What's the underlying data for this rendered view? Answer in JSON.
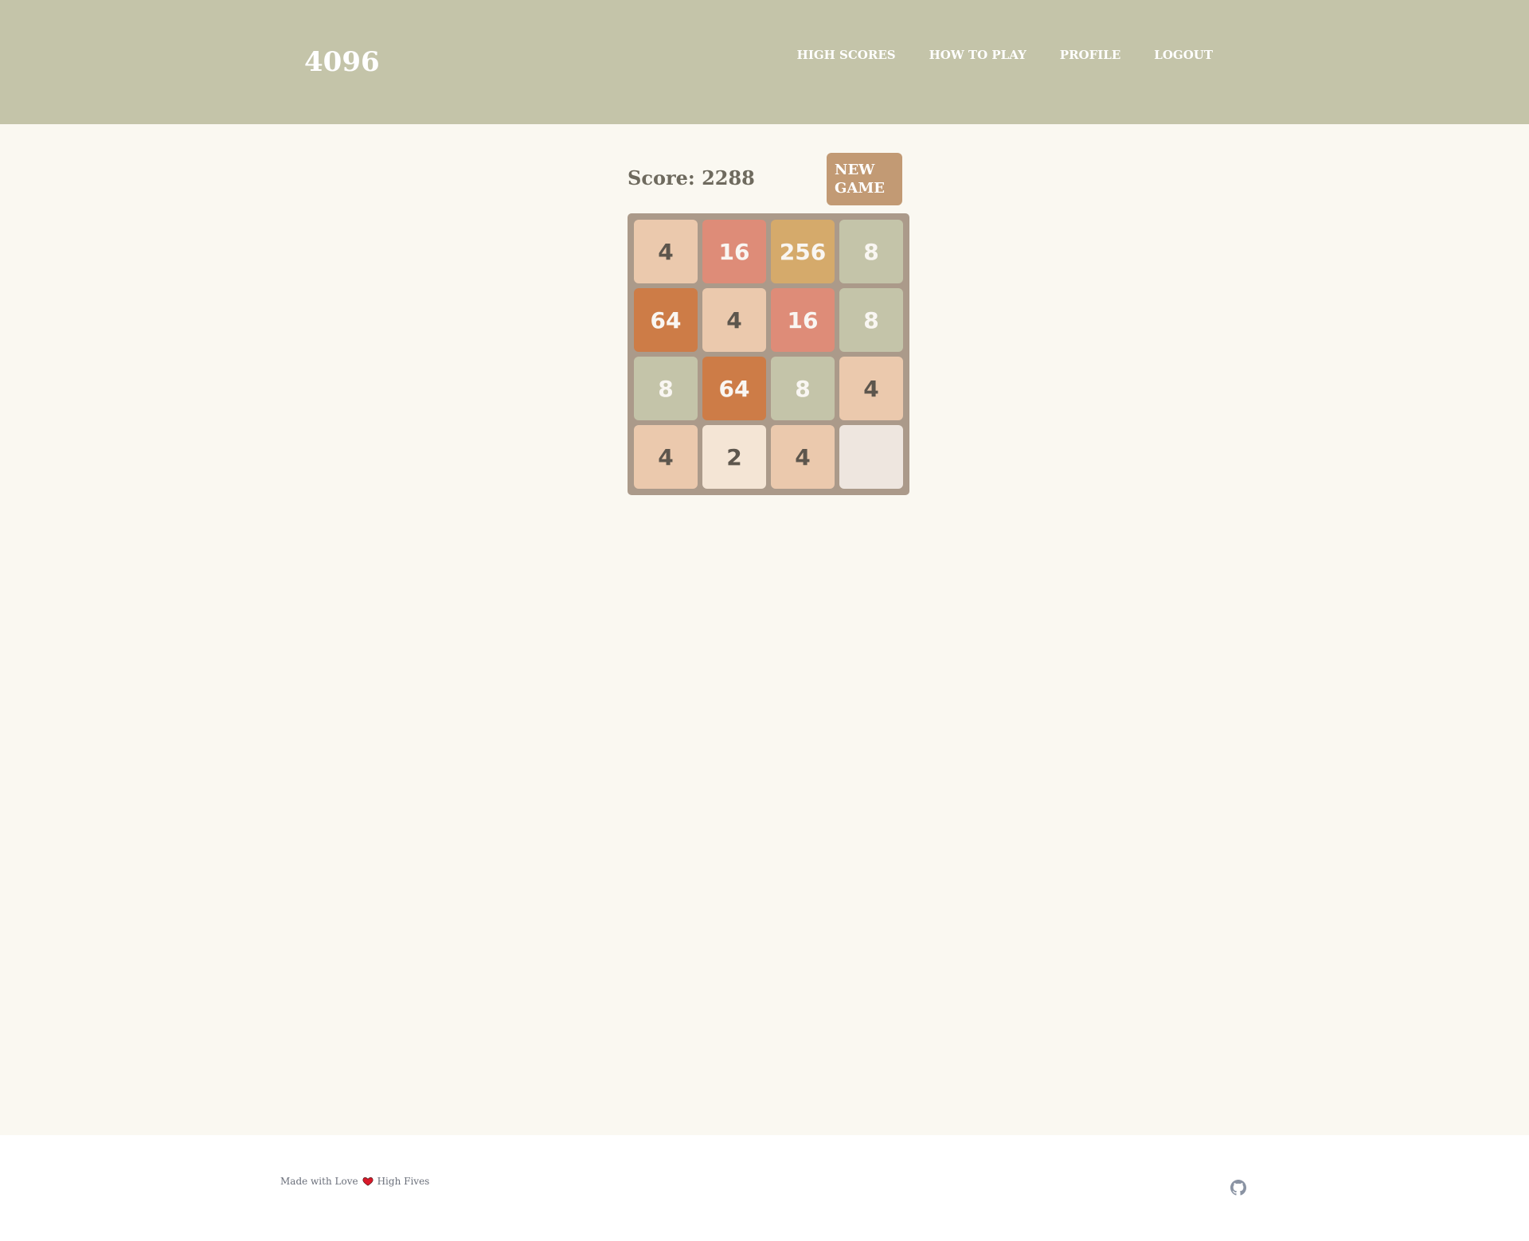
{
  "header": {
    "brand": "4096",
    "nav": [
      {
        "label": "HIGH SCORES"
      },
      {
        "label": "HOW TO PLAY"
      },
      {
        "label": "PROFILE"
      },
      {
        "label": "LOGOUT"
      }
    ]
  },
  "game": {
    "score_text": "Score: 2288",
    "new_game_label": "NEW GAME",
    "board": [
      [
        "4",
        "16",
        "256",
        "8"
      ],
      [
        "64",
        "4",
        "16",
        "8"
      ],
      [
        "8",
        "64",
        "8",
        "4"
      ],
      [
        "4",
        "2",
        "4",
        ""
      ]
    ]
  },
  "footer": {
    "made_with": "Made with Love",
    "high_fives": "High Fives",
    "heart_icon": "heart-icon",
    "github_icon": "github-icon"
  },
  "colors": {
    "header_bg": "#c4c4a9",
    "page_bg": "#faf8f1",
    "board_bg": "#ab9a8a",
    "button_bg": "#c29a74",
    "tile_2": "#f4e5d5",
    "tile_4": "#ebc9ad",
    "tile_8": "#c4c4a9",
    "tile_16": "#de8c78",
    "tile_64": "#cd7c47",
    "tile_256": "#d5aa6b",
    "tile_empty": "#eee6df"
  }
}
